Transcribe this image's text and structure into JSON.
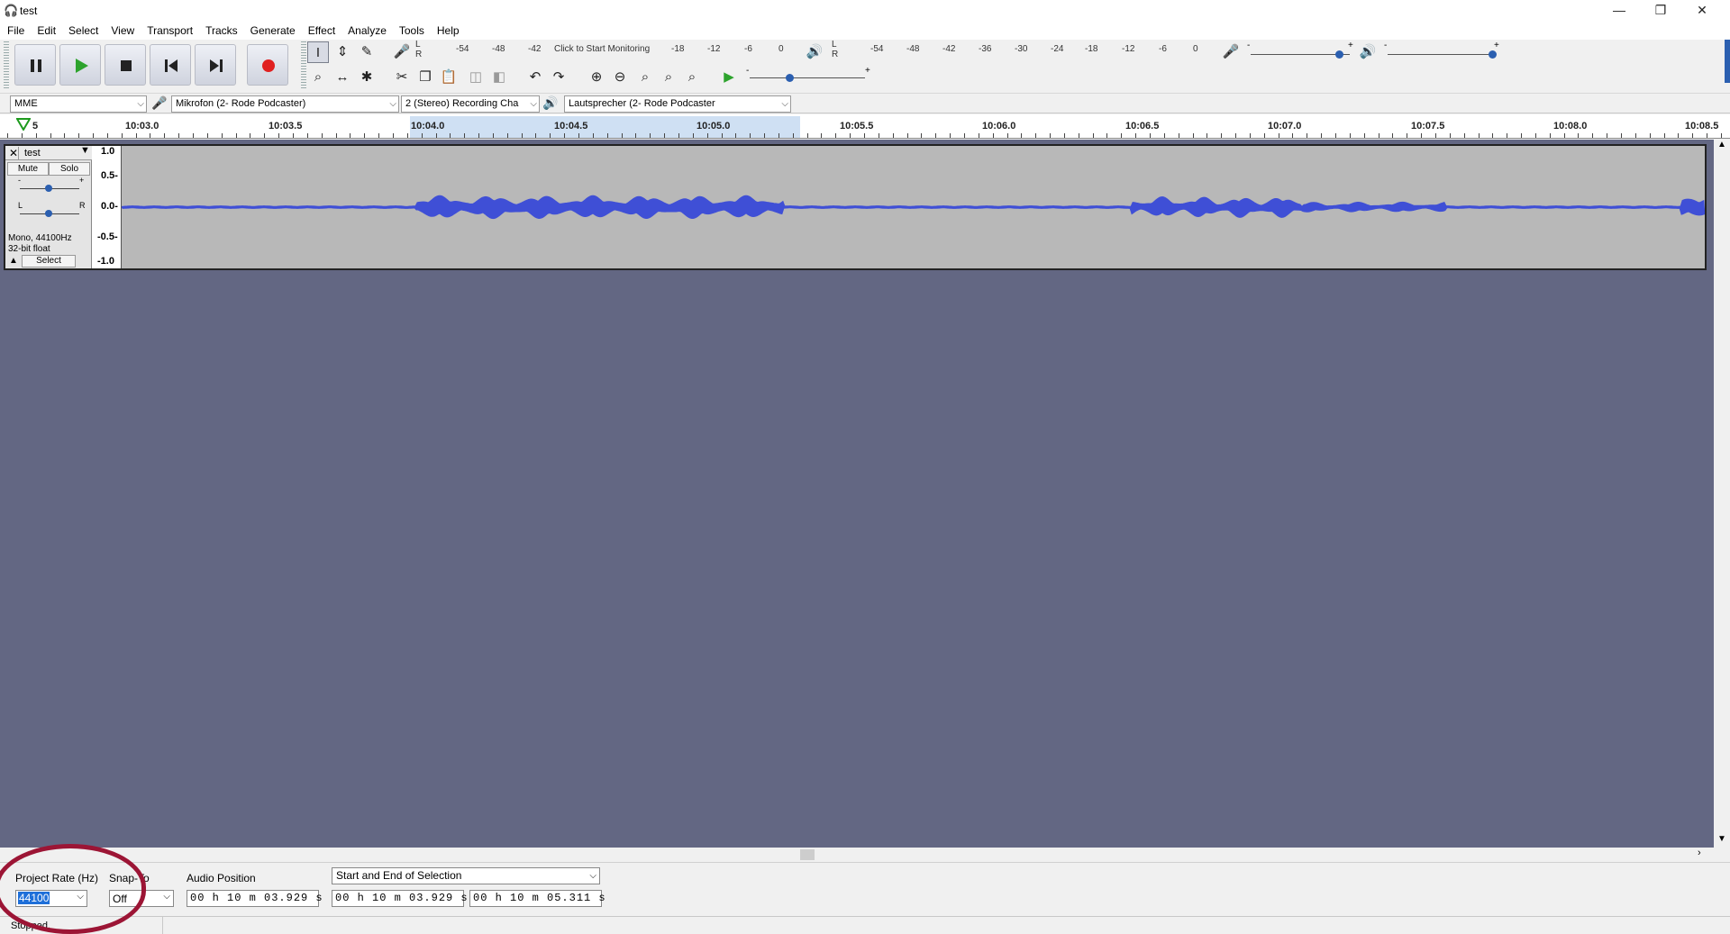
{
  "window": {
    "title": "test",
    "minimize": "—",
    "restore": "❐",
    "close": "✕"
  },
  "menu": [
    "File",
    "Edit",
    "Select",
    "View",
    "Transport",
    "Tracks",
    "Generate",
    "Effect",
    "Analyze",
    "Tools",
    "Help"
  ],
  "toolbar": {
    "record_meter_ticks": [
      "-54",
      "-48",
      "-42",
      "Click to Start Monitoring",
      "-18",
      "-12",
      "-6",
      "0"
    ],
    "play_meter_ticks": [
      "-54",
      "-48",
      "-42",
      "-36",
      "-30",
      "-24",
      "-18",
      "-12",
      "-6",
      "0"
    ],
    "meter_L": "L",
    "meter_R": "R",
    "slider_minus": "-",
    "slider_plus": "+"
  },
  "devices": {
    "host": "MME",
    "input": "Mikrofon (2- Rode Podcaster)",
    "channels": "2 (Stereo) Recording Cha",
    "output": "Lautsprecher (2- Rode Podcaster"
  },
  "ruler": {
    "labels": [
      "5",
      "10:03.0",
      "10:03.5",
      "10:04.0",
      "10:04.5",
      "10:05.0",
      "10:05.5",
      "10:06.0",
      "10:06.5",
      "10:07.0",
      "10:07.5",
      "10:08.0",
      "10:08.5"
    ]
  },
  "track": {
    "name": "test",
    "mute": "Mute",
    "solo": "Solo",
    "gain_minus": "-",
    "gain_plus": "+",
    "pan_left": "L",
    "pan_right": "R",
    "info_line1": "Mono, 44100Hz",
    "info_line2": "32-bit float",
    "select": "Select",
    "scale": [
      "1.0",
      "0.5-",
      "0.0-",
      "-0.5-",
      "-1.0"
    ]
  },
  "selection_toolbar": {
    "project_rate_label": "Project Rate (Hz)",
    "project_rate_value": "44100",
    "snap_label": "Snap-To",
    "snap_value": "Off",
    "audio_position_label": "Audio Position",
    "audio_position_value": "00 h 10 m 03.929 s",
    "selection_mode": "Start and End of Selection",
    "selection_start": "00 h 10 m 03.929 s",
    "selection_end": "00 h 10 m 05.311 s"
  },
  "status": {
    "text": "Stopped."
  },
  "colors": {
    "waveform": "#3f4fd6",
    "background": "#636783",
    "annotation": "#9c1535"
  }
}
